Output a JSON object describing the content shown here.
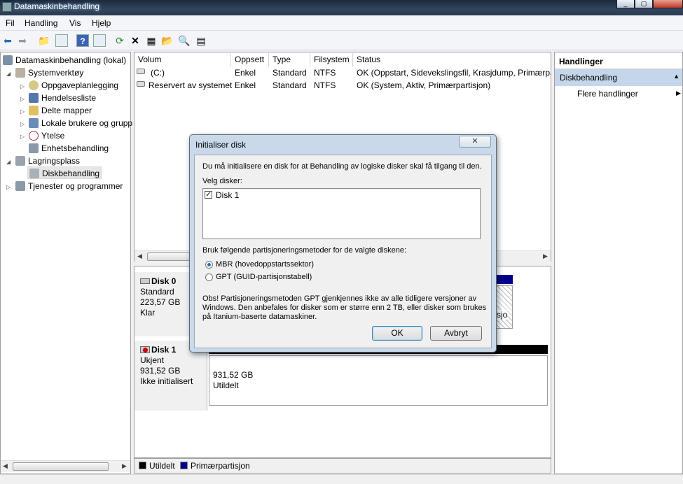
{
  "window": {
    "title": "Datamaskinbehandling"
  },
  "menu": [
    "Fil",
    "Handling",
    "Vis",
    "Hjelp"
  ],
  "tree": {
    "root": "Datamaskinbehandling (lokal)",
    "system_tools": "Systemverktøy",
    "task_scheduler": "Oppgaveplanlegging",
    "event_viewer": "Hendelsesliste",
    "shared_folders": "Delte mapper",
    "local_users": "Lokale brukere og grupp",
    "performance": "Ytelse",
    "device_manager": "Enhetsbehandling",
    "storage": "Lagringsplass",
    "disk_management": "Diskbehandling",
    "services": "Tjenester og programmer"
  },
  "volumes": {
    "columns": [
      "Volum",
      "Oppsett",
      "Type",
      "Filsystem",
      "Status"
    ],
    "rows": [
      {
        "volum": "(C:)",
        "oppsett": "Enkel",
        "type": "Standard",
        "filsystem": "NTFS",
        "status": "OK (Oppstart, Sidevekslingsfil, Krasjdump, Primærpa"
      },
      {
        "volum": "Reservert av systemet",
        "oppsett": "Enkel",
        "type": "Standard",
        "filsystem": "NTFS",
        "status": "OK (System, Aktiv, Primærpartisjon)"
      }
    ]
  },
  "disks": {
    "disk0": {
      "name": "Disk 0",
      "type": "Standard",
      "size": "223,57 GB",
      "state": "Klar",
      "partial_text": "sjo"
    },
    "disk1": {
      "name": "Disk 1",
      "type": "Ukjent",
      "size": "931,52 GB",
      "state": "Ikke initialisert",
      "partition_size": "931,52 GB",
      "partition_state": "Utildelt"
    }
  },
  "legend": {
    "unallocated": "Utildelt",
    "primary": "Primærpartisjon",
    "unallocated_color": "#000000",
    "primary_color": "#00008b"
  },
  "actions": {
    "header": "Handlinger",
    "section": "Diskbehandling",
    "more": "Flere handlinger"
  },
  "dialog": {
    "title": "Initialiser disk",
    "close_label": "✕",
    "intro": "Du må initialisere en disk for at Behandling av logiske disker skal få tilgang til den.",
    "select_label": "Velg disker:",
    "disk_item": "Disk 1",
    "method_label": "Bruk følgende partisjoneringsmetoder for de valgte diskene:",
    "mbr": "MBR (hovedoppstartssektor)",
    "gpt": "GPT (GUID-partisjonstabell)",
    "note_line1": "Obs!  Partisjoneringsmetoden GPT gjenkjennes ikke av alle tidligere versjoner av",
    "note_line2": "Windows. Den anbefales for disker som er større enn 2 TB, eller disker som brukes",
    "note_line3": "på Itanium-baserte datamaskiner.",
    "ok": "OK",
    "cancel": "Avbryt"
  }
}
